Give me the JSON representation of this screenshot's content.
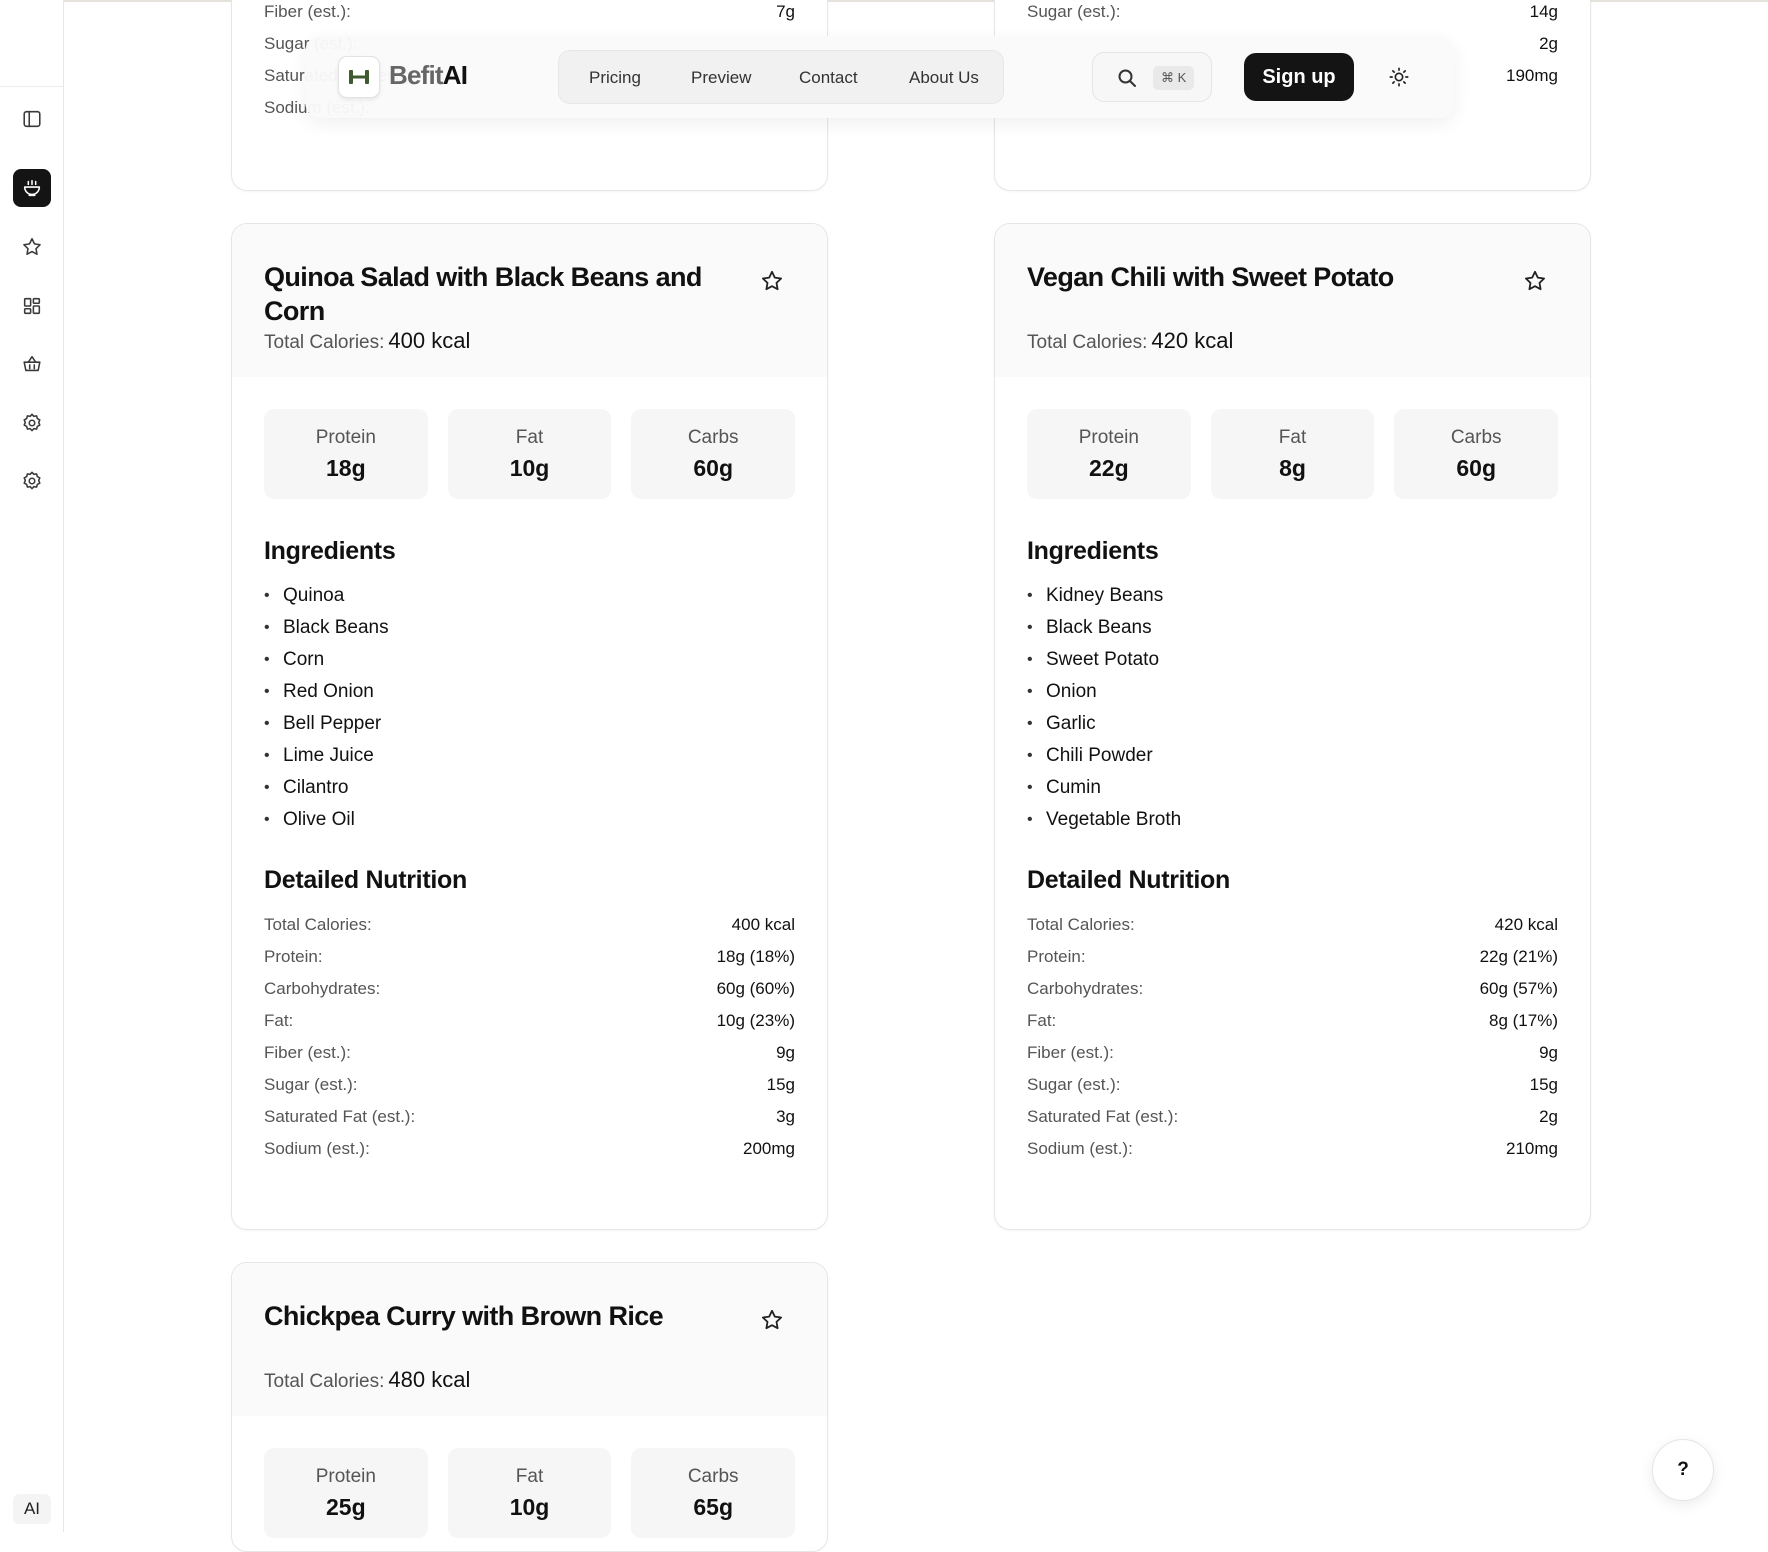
{
  "brand": {
    "part1": "Befit",
    "part2": "AI"
  },
  "nav": {
    "links": [
      "Pricing",
      "Preview",
      "Contact",
      "About Us"
    ],
    "search_shortcut": "⌘ K",
    "signup_label": "Sign up"
  },
  "sidebar": {
    "ai_label": "AI",
    "icons": [
      "sidebar-toggle-icon",
      "bowl-icon",
      "star-icon",
      "grid-icon",
      "basket-icon",
      "settings-icon",
      "settings-alt-icon"
    ]
  },
  "help_label": "?",
  "cal_label": "Total Calories:",
  "macro_labels": {
    "protein": "Protein",
    "fat": "Fat",
    "carbs": "Carbs"
  },
  "section_titles": {
    "ingredients": "Ingredients",
    "nutrition": "Detailed Nutrition"
  },
  "partial_left": [
    {
      "label": "Fiber (est.):",
      "value": "7g"
    },
    {
      "label": "Sugar (est.):",
      "value": ""
    },
    {
      "label": "Saturated Fat (est.):",
      "value": ""
    },
    {
      "label": "Sodium (est.):",
      "value": ""
    }
  ],
  "partial_right": [
    {
      "label": "Sugar (est.):",
      "value": "14g"
    },
    {
      "label": "",
      "value": "2g"
    },
    {
      "label": "",
      "value": "190mg"
    }
  ],
  "recipes": [
    {
      "title": "Quinoa Salad with Black Beans and Corn",
      "calories": "400 kcal",
      "protein": "18g",
      "fat": "10g",
      "carbs": "60g",
      "ingredients": [
        "Quinoa",
        "Black Beans",
        "Corn",
        "Red Onion",
        "Bell Pepper",
        "Lime Juice",
        "Cilantro",
        "Olive Oil"
      ],
      "nutrition": [
        {
          "label": "Total Calories:",
          "value": "400 kcal"
        },
        {
          "label": "Protein:",
          "value": "18g (18%)"
        },
        {
          "label": "Carbohydrates:",
          "value": "60g (60%)"
        },
        {
          "label": "Fat:",
          "value": "10g (23%)"
        },
        {
          "label": "Fiber (est.):",
          "value": "9g"
        },
        {
          "label": "Sugar (est.):",
          "value": "15g"
        },
        {
          "label": "Saturated Fat (est.):",
          "value": "3g"
        },
        {
          "label": "Sodium (est.):",
          "value": "200mg"
        }
      ]
    },
    {
      "title": "Vegan Chili with Sweet Potato",
      "calories": "420 kcal",
      "protein": "22g",
      "fat": "8g",
      "carbs": "60g",
      "ingredients": [
        "Kidney Beans",
        "Black Beans",
        "Sweet Potato",
        "Onion",
        "Garlic",
        "Chili Powder",
        "Cumin",
        "Vegetable Broth"
      ],
      "nutrition": [
        {
          "label": "Total Calories:",
          "value": "420 kcal"
        },
        {
          "label": "Protein:",
          "value": "22g (21%)"
        },
        {
          "label": "Carbohydrates:",
          "value": "60g (57%)"
        },
        {
          "label": "Fat:",
          "value": "8g (17%)"
        },
        {
          "label": "Fiber (est.):",
          "value": "9g"
        },
        {
          "label": "Sugar (est.):",
          "value": "15g"
        },
        {
          "label": "Saturated Fat (est.):",
          "value": "2g"
        },
        {
          "label": "Sodium (est.):",
          "value": "210mg"
        }
      ]
    },
    {
      "title": "Chickpea Curry with Brown Rice",
      "calories": "480 kcal",
      "protein": "25g",
      "fat": "10g",
      "carbs": "65g"
    }
  ]
}
